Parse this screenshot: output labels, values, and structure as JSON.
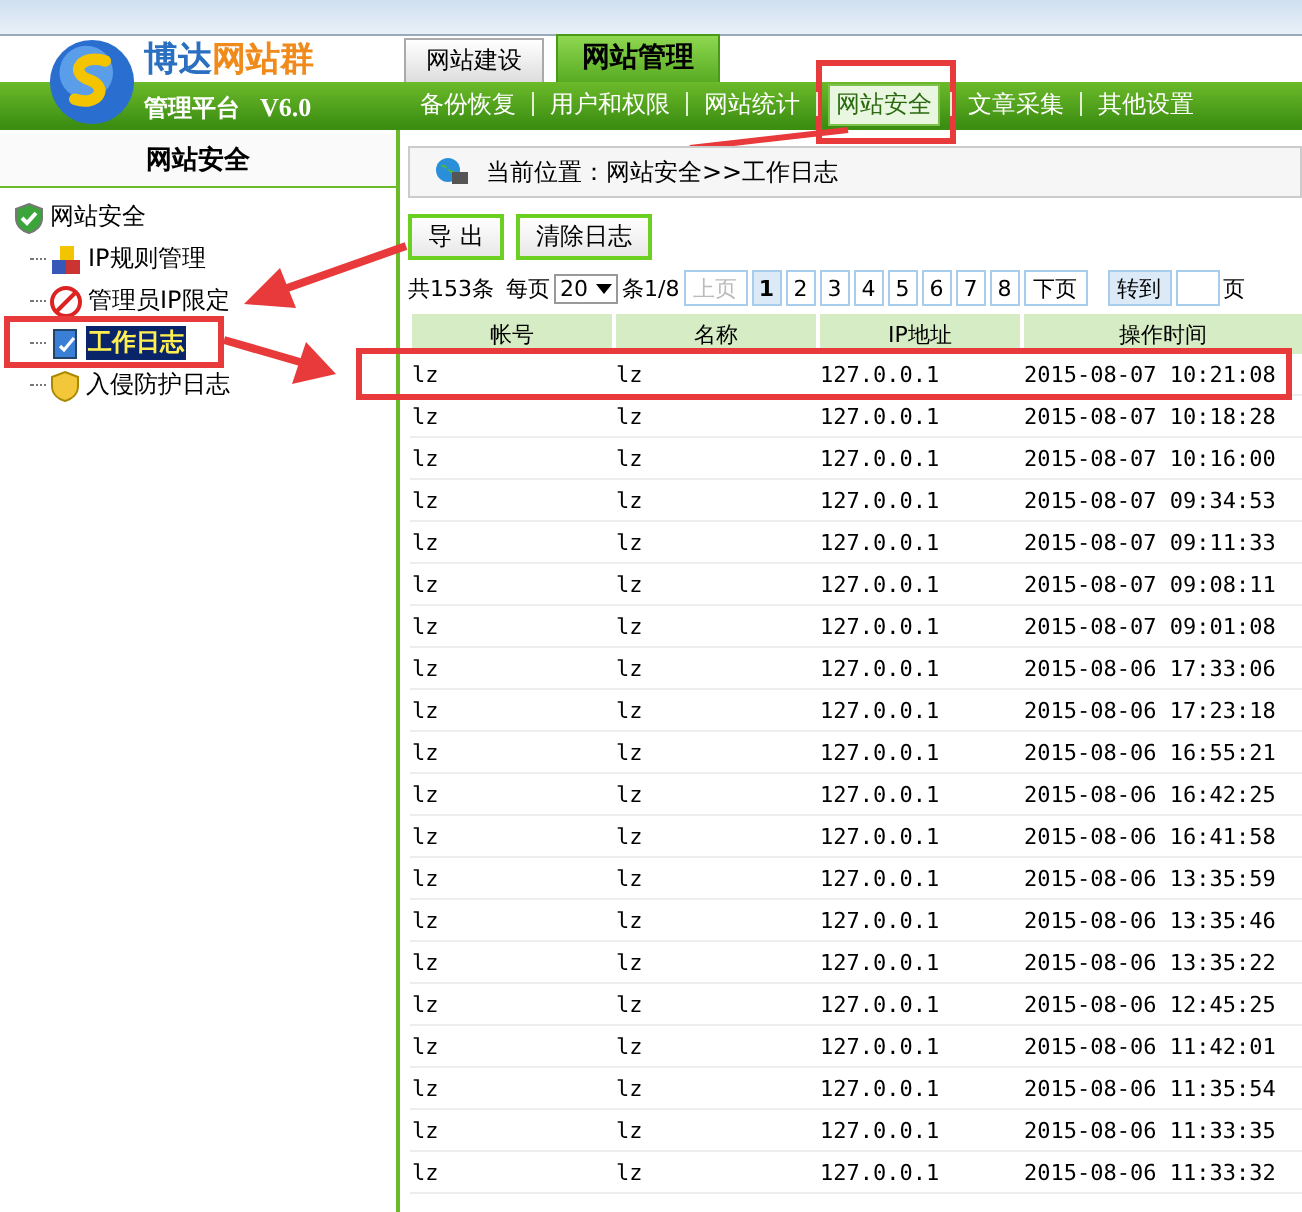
{
  "brand": {
    "name_part1": "博达",
    "name_part2": "网站群",
    "subtitle": "管理平台",
    "version": "V6.0"
  },
  "top_tabs": [
    {
      "label": "网站建设",
      "selected": false
    },
    {
      "label": "网站管理",
      "selected": true
    }
  ],
  "nav": [
    {
      "label": "备份恢复",
      "selected": false
    },
    {
      "label": "用户和权限",
      "selected": false
    },
    {
      "label": "网站统计",
      "selected": false
    },
    {
      "label": "网站安全",
      "selected": true
    },
    {
      "label": "文章采集",
      "selected": false
    },
    {
      "label": "其他设置",
      "selected": false
    }
  ],
  "sidebar": {
    "title": "网站安全",
    "tree": [
      {
        "label": "网站安全",
        "selected": false,
        "children": [
          {
            "label": "IP规则管理",
            "selected": false
          },
          {
            "label": "管理员IP限定",
            "selected": false
          },
          {
            "label": "工作日志",
            "selected": true
          },
          {
            "label": "入侵防护日志",
            "selected": false
          }
        ]
      }
    ]
  },
  "breadcrumb": "当前位置：网站安全>>工作日志",
  "actions": [
    "导 出",
    "清除日志"
  ],
  "pager": {
    "total": "共153条",
    "per_page_label": "每页",
    "per_page": "20",
    "suffix": "条1/8",
    "prev": "上页",
    "prev_disabled": true,
    "pages": [
      {
        "label": "1",
        "selected": true
      },
      {
        "label": "2",
        "selected": false
      },
      {
        "label": "3",
        "selected": false
      },
      {
        "label": "4",
        "selected": false
      },
      {
        "label": "5",
        "selected": false
      },
      {
        "label": "6",
        "selected": false
      },
      {
        "label": "7",
        "selected": false
      },
      {
        "label": "8",
        "selected": false
      }
    ],
    "next": "下页",
    "goto": "转到",
    "page_unit": "页"
  },
  "table": {
    "columns": [
      "帐号",
      "名称",
      "IP地址",
      "操作时间"
    ],
    "rows": [
      [
        "lz",
        "lz",
        "127.0.0.1",
        "2015-08-07 10:21:08"
      ],
      [
        "lz",
        "lz",
        "127.0.0.1",
        "2015-08-07 10:18:28"
      ],
      [
        "lz",
        "lz",
        "127.0.0.1",
        "2015-08-07 10:16:00"
      ],
      [
        "lz",
        "lz",
        "127.0.0.1",
        "2015-08-07 09:34:53"
      ],
      [
        "lz",
        "lz",
        "127.0.0.1",
        "2015-08-07 09:11:33"
      ],
      [
        "lz",
        "lz",
        "127.0.0.1",
        "2015-08-07 09:08:11"
      ],
      [
        "lz",
        "lz",
        "127.0.0.1",
        "2015-08-07 09:01:08"
      ],
      [
        "lz",
        "lz",
        "127.0.0.1",
        "2015-08-06 17:33:06"
      ],
      [
        "lz",
        "lz",
        "127.0.0.1",
        "2015-08-06 17:23:18"
      ],
      [
        "lz",
        "lz",
        "127.0.0.1",
        "2015-08-06 16:55:21"
      ],
      [
        "lz",
        "lz",
        "127.0.0.1",
        "2015-08-06 16:42:25"
      ],
      [
        "lz",
        "lz",
        "127.0.0.1",
        "2015-08-06 16:41:58"
      ],
      [
        "lz",
        "lz",
        "127.0.0.1",
        "2015-08-06 13:35:59"
      ],
      [
        "lz",
        "lz",
        "127.0.0.1",
        "2015-08-06 13:35:46"
      ],
      [
        "lz",
        "lz",
        "127.0.0.1",
        "2015-08-06 13:35:22"
      ],
      [
        "lz",
        "lz",
        "127.0.0.1",
        "2015-08-06 12:45:25"
      ],
      [
        "lz",
        "lz",
        "127.0.0.1",
        "2015-08-06 11:42:01"
      ],
      [
        "lz",
        "lz",
        "127.0.0.1",
        "2015-08-06 11:35:54"
      ],
      [
        "lz",
        "lz",
        "127.0.0.1",
        "2015-08-06 11:33:35"
      ],
      [
        "lz",
        "lz",
        "127.0.0.1",
        "2015-08-06 11:33:32"
      ]
    ]
  }
}
